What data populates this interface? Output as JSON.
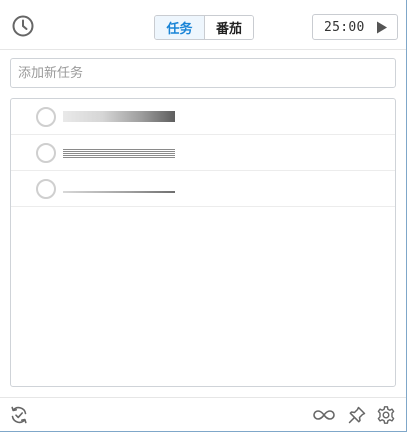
{
  "header": {
    "tabs": [
      {
        "label": "任务",
        "active": true
      },
      {
        "label": "番茄",
        "active": false
      }
    ],
    "timer": {
      "time": "25:00"
    }
  },
  "input": {
    "placeholder": "添加新任务"
  },
  "tasks": [
    {
      "title": "",
      "style": "gradient"
    },
    {
      "title": "",
      "style": "lines"
    },
    {
      "title": "",
      "style": "thin"
    }
  ],
  "icons": {
    "clock": "clock-icon",
    "play": "play-icon",
    "sync": "sync-check-icon",
    "loop": "infinity-icon",
    "pin": "pin-icon",
    "settings": "gear-icon"
  },
  "colors": {
    "accent": "#1a84d6",
    "icon": "#666666",
    "border": "#cfd3d8"
  }
}
